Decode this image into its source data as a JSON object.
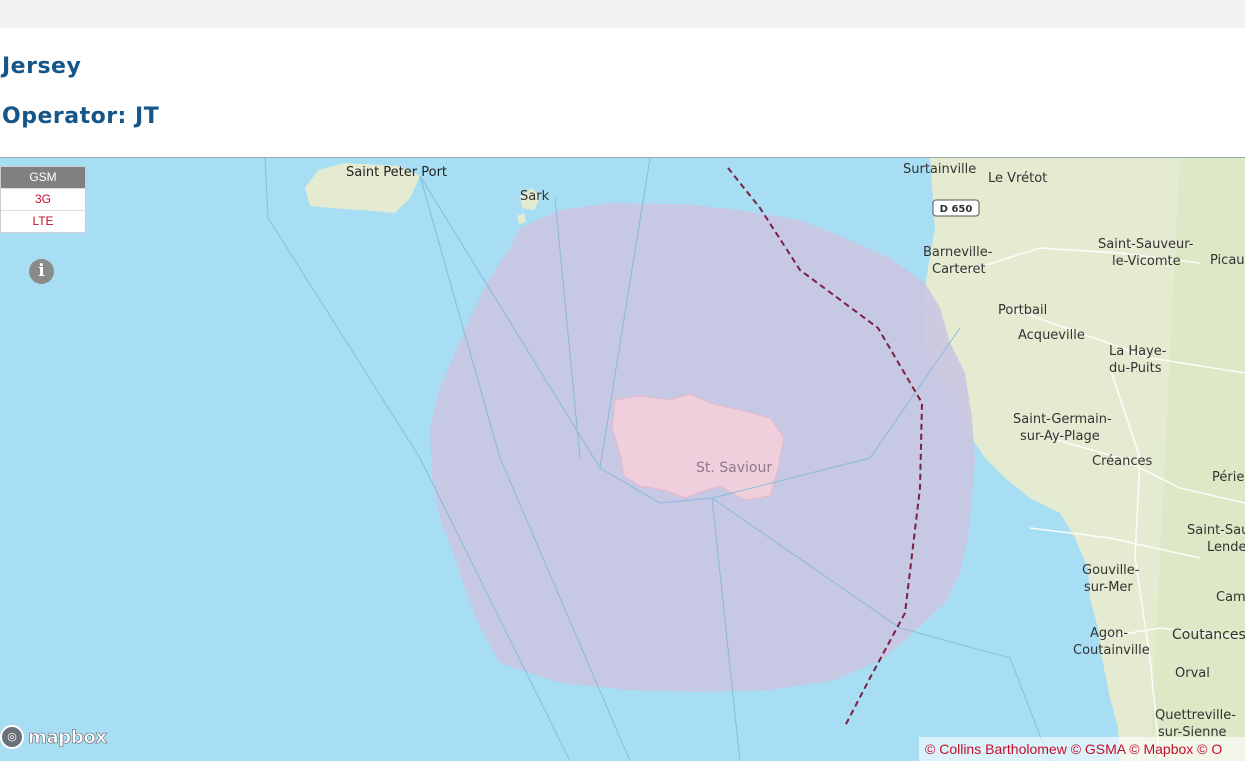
{
  "header": {
    "country": "Jersey",
    "operator": "Operator: JT"
  },
  "legend": {
    "items": [
      "GSM",
      "3G",
      "LTE"
    ],
    "active": "GSM"
  },
  "info_icon": "info-icon",
  "map": {
    "labels": {
      "saint_peter_port": "Saint Peter Port",
      "sark": "Sark",
      "st_saviour": "St. Saviour",
      "surtainville": "Surtainville",
      "le_vretot": "Le Vrétot",
      "d650": "D 650",
      "barneville_1": "Barneville-",
      "barneville_2": "Carteret",
      "saint_sauveur_1": "Saint-Sauveur-",
      "saint_sauveur_2": "le-Vicomte",
      "picau": "Picau",
      "portbail": "Portbail",
      "acqueville": "Acqueville",
      "la_haye_1": "La Haye-",
      "la_haye_2": "du-Puits",
      "st_germain_1": "Saint-Germain-",
      "st_germain_2": "sur-Ay-Plage",
      "creances": "Créances",
      "perie": "Périe",
      "saint_sau_1": "Saint-Sau",
      "saint_sau_2": "Lende",
      "gouville_1": "Gouville-",
      "gouville_2": "sur-Mer",
      "cam": "Cam",
      "agon_1": "Agon-",
      "agon_2": "Coutainville",
      "coutances": "Coutances",
      "orval": "Orval",
      "quettreville_1": "Quettreville-",
      "quettreville_2": "sur-Sienne"
    },
    "colors": {
      "sea": "#a8def4",
      "land": "#e6ecd2",
      "coverage": "#c9c5e2",
      "island": "#efcfdc",
      "border": "#7a2040"
    }
  },
  "logo": {
    "text": "mapbox"
  },
  "attribution": "© Collins Bartholomew © GSMA © Mapbox © O"
}
